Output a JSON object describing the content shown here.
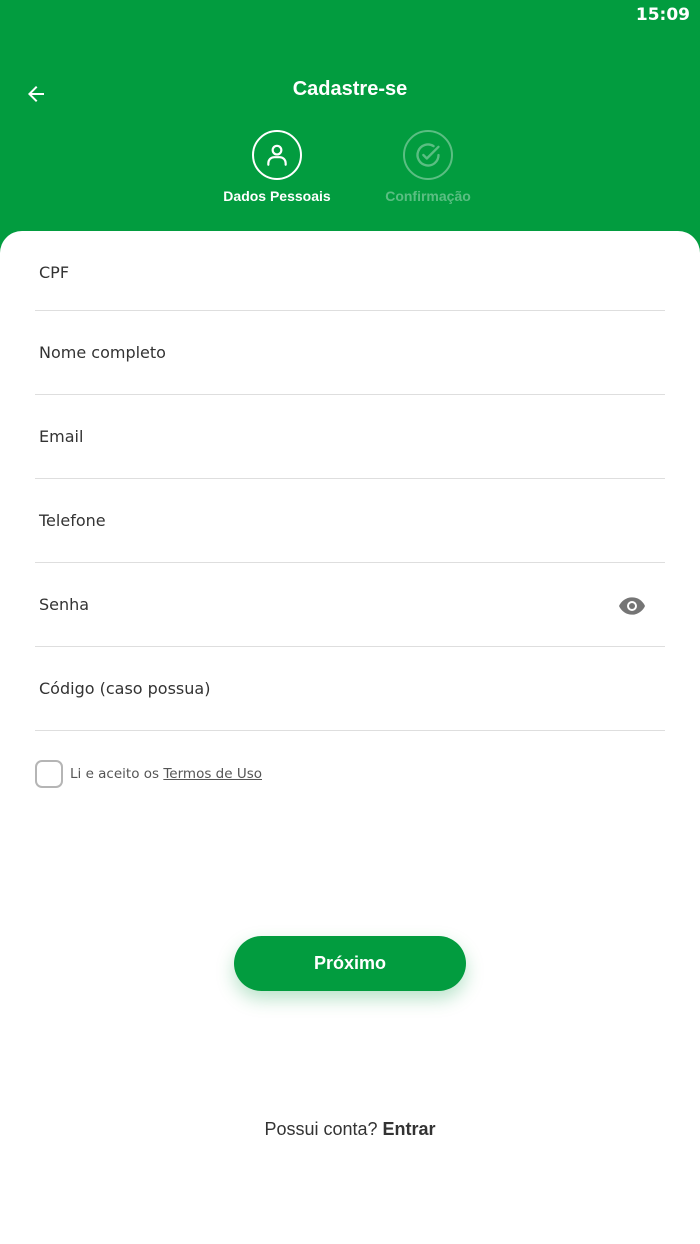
{
  "status_bar": {
    "time": "15:09"
  },
  "header": {
    "title": "Cadastre-se",
    "steps": [
      {
        "label": "Dados Pessoais",
        "icon": "user-icon",
        "active": true
      },
      {
        "label": "Confirmação",
        "icon": "check-circle-icon",
        "active": false
      }
    ]
  },
  "form": {
    "fields": [
      {
        "label": "CPF",
        "value": ""
      },
      {
        "label": "Nome completo",
        "value": ""
      },
      {
        "label": "Email",
        "value": ""
      },
      {
        "label": "Telefone",
        "value": ""
      },
      {
        "label": "Senha",
        "value": ""
      },
      {
        "label": "Código (caso possua)",
        "value": ""
      }
    ],
    "terms": {
      "prefix": "Li e aceito os ",
      "link": "Termos de Uso",
      "checked": false
    },
    "next_label": "Próximo"
  },
  "footer": {
    "question": "Possui conta? ",
    "login_label": "Entrar"
  },
  "colors": {
    "primary": "#029c3f",
    "text": "#333333",
    "divider": "#dedede"
  }
}
